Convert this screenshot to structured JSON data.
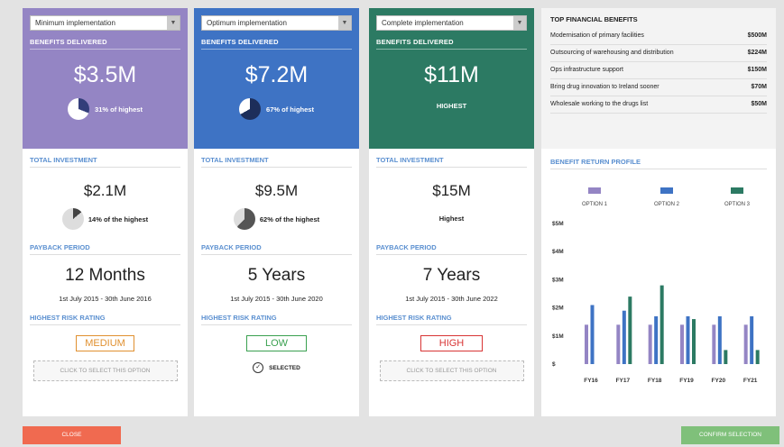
{
  "options": [
    {
      "select_label": "Minimum implementation",
      "color": "#9485c4",
      "benefits_head": "BENEFITS DELIVERED",
      "benefits_value": "$3.5M",
      "benefits_share": 0.31,
      "benefits_label": "31% of highest",
      "invest_head": "TOTAL INVESTMENT",
      "invest_value": "$2.1M",
      "invest_share": 0.14,
      "invest_label": "14% of the highest",
      "payback_head": "PAYBACK PERIOD",
      "payback_value": "12 Months",
      "payback_dates": "1st July 2015 - 30th June 2016",
      "risk_head": "HIGHEST RISK RATING",
      "risk_value": "MEDIUM",
      "action_label": "CLICK TO SELECT THIS OPTION"
    },
    {
      "select_label": "Optimum implementation",
      "color": "#3e73c4",
      "benefits_head": "BENEFITS DELIVERED",
      "benefits_value": "$7.2M",
      "benefits_share": 0.67,
      "benefits_label": "67% of highest",
      "invest_head": "TOTAL INVESTMENT",
      "invest_value": "$9.5M",
      "invest_share": 0.62,
      "invest_label": "62% of the highest",
      "payback_head": "PAYBACK PERIOD",
      "payback_value": "5 Years",
      "payback_dates": "1st July 2015 - 30th June 2020",
      "risk_head": "HIGHEST RISK RATING",
      "risk_value": "LOW",
      "action_label": "SELECTED"
    },
    {
      "select_label": "Complete implementation",
      "color": "#2c7a63",
      "benefits_head": "BENEFITS DELIVERED",
      "benefits_value": "$11M",
      "benefits_label": "HIGHEST",
      "invest_head": "TOTAL INVESTMENT",
      "invest_value": "$15M",
      "invest_label": "Highest",
      "payback_head": "PAYBACK PERIOD",
      "payback_value": "7 Years",
      "payback_dates": "1st July 2015 - 30th June 2022",
      "risk_head": "HIGHEST RISK RATING",
      "risk_value": "HIGH",
      "action_label": "CLICK TO SELECT THIS OPTION"
    }
  ],
  "top_benefits": {
    "title": "TOP FINANCIAL BENEFITS",
    "rows": [
      {
        "label": "Modernisation of primary facilities",
        "value": "$500M"
      },
      {
        "label": "Outsourcing of warehousing and distribution",
        "value": "$224M"
      },
      {
        "label": "Ops infrastructure support",
        "value": "$150M"
      },
      {
        "label": "Bring drug innovation to Ireland sooner",
        "value": "$70M"
      },
      {
        "label": "Wholesale working to the drugs list",
        "value": "$50M"
      }
    ]
  },
  "chart_data": {
    "type": "bar",
    "title": "BENEFIT RETURN PROFILE",
    "categories": [
      "FY16",
      "FY17",
      "FY18",
      "FY19",
      "FY20",
      "FY21"
    ],
    "series": [
      {
        "name": "OPTION 1",
        "color": "#9485c4",
        "values": [
          1.4,
          1.4,
          1.4,
          1.4,
          1.4,
          1.4
        ]
      },
      {
        "name": "OPTION 2",
        "color": "#3e73c4",
        "values": [
          2.1,
          1.9,
          1.7,
          1.7,
          1.7,
          1.7
        ]
      },
      {
        "name": "OPTION 3",
        "color": "#2c7a63",
        "values": [
          0,
          2.4,
          2.8,
          1.6,
          0.5,
          0.5
        ]
      }
    ],
    "ylim": [
      0,
      5
    ],
    "yticks": [
      "$5M",
      "$4M",
      "$3M",
      "$2M",
      "$1M",
      "$"
    ],
    "legend_position": "top",
    "grid": false
  },
  "footer": {
    "close_label": "CLOSE",
    "confirm_label": "CONFIRM SELECTION"
  }
}
